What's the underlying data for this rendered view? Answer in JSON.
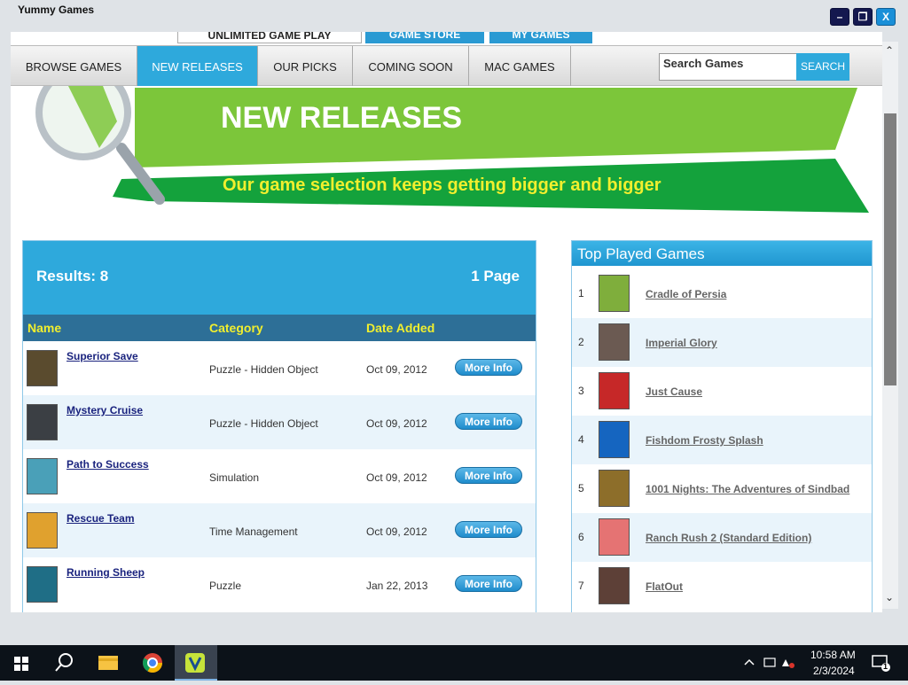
{
  "window": {
    "title": "Yummy Games",
    "min_label": "–",
    "max_label": "❐",
    "close_label": "X"
  },
  "top_tabs": [
    "UNLIMITED GAME PLAY",
    "GAME STORE",
    "MY GAMES"
  ],
  "nav": {
    "items": [
      "BROWSE GAMES",
      "NEW RELEASES",
      "OUR PICKS",
      "COMING SOON",
      "MAC GAMES"
    ],
    "active": "NEW RELEASES",
    "search_placeholder": "Search Games",
    "search_button": "SEARCH"
  },
  "banner": {
    "title": "NEW RELEASES",
    "subtitle": "Our game selection keeps getting bigger and bigger"
  },
  "results": {
    "count_label": "Results: 8",
    "pages_label": "1 Page",
    "columns": [
      "Name",
      "Category",
      "Date Added"
    ],
    "more_label": "More Info",
    "rows": [
      {
        "name": "Superior Save",
        "category": "Puzzle - Hidden Object",
        "date": "Oct 09, 2012",
        "thumb_color": "#5a4b2e"
      },
      {
        "name": "Mystery Cruise",
        "category": "Puzzle - Hidden Object",
        "date": "Oct 09, 2012",
        "thumb_color": "#3b3f44"
      },
      {
        "name": "Path to Success",
        "category": "Simulation",
        "date": "Oct 09, 2012",
        "thumb_color": "#4aa0b8"
      },
      {
        "name": "Rescue Team",
        "category": "Time Management",
        "date": "Oct 09, 2012",
        "thumb_color": "#e0a12e"
      },
      {
        "name": "Running Sheep",
        "category": "Puzzle",
        "date": "Jan 22, 2013",
        "thumb_color": "#1f6e86"
      }
    ]
  },
  "top_played": {
    "title": "Top Played Games",
    "items": [
      {
        "rank": "1",
        "name": "Cradle of Persia",
        "thumb_color": "#7fae3c"
      },
      {
        "rank": "2",
        "name": "Imperial Glory",
        "thumb_color": "#6b5a52"
      },
      {
        "rank": "3",
        "name": "Just Cause",
        "thumb_color": "#c62828"
      },
      {
        "rank": "4",
        "name": "Fishdom Frosty Splash",
        "thumb_color": "#1565c0"
      },
      {
        "rank": "5",
        "name": "1001 Nights: The Adventures of Sindbad",
        "thumb_color": "#8d6e2a"
      },
      {
        "rank": "6",
        "name": "Ranch Rush 2 (Standard Edition)",
        "thumb_color": "#e57373"
      },
      {
        "rank": "7",
        "name": "FlatOut",
        "thumb_color": "#5d4037"
      }
    ]
  },
  "taskbar": {
    "time": "10:58 AM",
    "date": "2/3/2024",
    "notification_count": "1"
  },
  "colors": {
    "accent": "#2ea9dc",
    "banner_green": "#7cc63a",
    "banner_dark_green": "#14a23c",
    "subtitle_yellow": "#f1ef2e"
  }
}
